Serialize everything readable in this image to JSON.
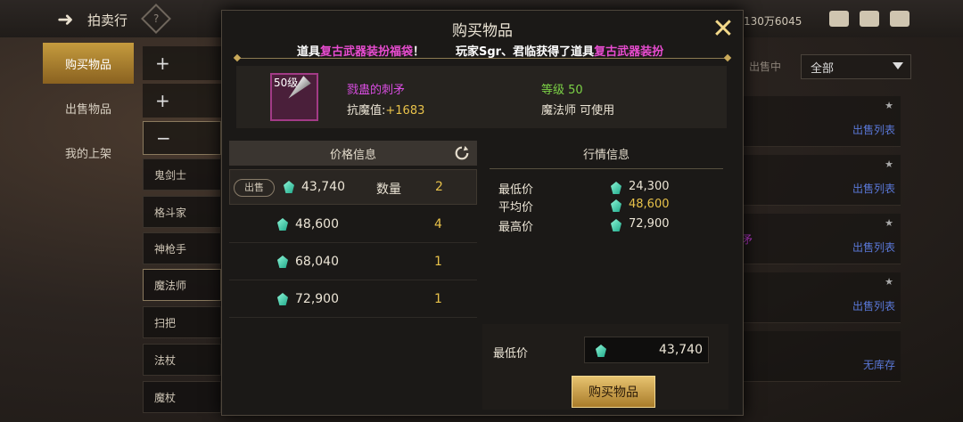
{
  "background": {
    "title": "拍卖行",
    "currency_text": "130万6045",
    "left_nav": [
      "购买物品",
      "出售物品",
      "我的上架"
    ],
    "categories": [
      "鬼剑士",
      "格斗家",
      "神枪手",
      "魔法师",
      "扫把",
      "法杖",
      "魔杖"
    ],
    "filter_label": "出售中",
    "filter_value": "全部",
    "list_links": [
      "出售列表",
      "出售列表",
      "出售列表",
      "出售列表",
      "无库存"
    ],
    "purple_text": "矛"
  },
  "modal": {
    "title": "购买物品",
    "marquee_1_prefix": "道具",
    "marquee_1_highlight": "复古武器装扮福袋",
    "marquee_1_suffix": "！",
    "marquee_2_prefix": "玩家Sgr、君临获得了道具",
    "marquee_2_highlight": "复古武器装扮",
    "item": {
      "level_badge": "50级",
      "name": "戮蛊的刺矛",
      "stat_label": "抗魔值:",
      "stat_value": "+1683",
      "level_text": "等级 50",
      "job_text": "魔法师 可使用"
    },
    "price_info": {
      "header": "价格信息",
      "sell_badge": "出售",
      "quantity_label": "数量",
      "rows": [
        {
          "price": "43,740",
          "qty": "2"
        },
        {
          "price": "48,600",
          "qty": "4"
        },
        {
          "price": "68,040",
          "qty": "1"
        },
        {
          "price": "72,900",
          "qty": "1"
        }
      ]
    },
    "market_info": {
      "header": "行情信息",
      "rows": [
        {
          "label": "最低价",
          "value": "24,300"
        },
        {
          "label": "平均价",
          "value": "48,600"
        },
        {
          "label": "最高价",
          "value": "72,900"
        }
      ]
    },
    "min_price_label": "最低价",
    "min_price_value": "43,740",
    "buy_button": "购买物品"
  },
  "colors": {
    "item_name": "#d84de0",
    "level_green": "#7cd246",
    "gold": "#e8c24a",
    "link_blue": "#5a78d8"
  }
}
